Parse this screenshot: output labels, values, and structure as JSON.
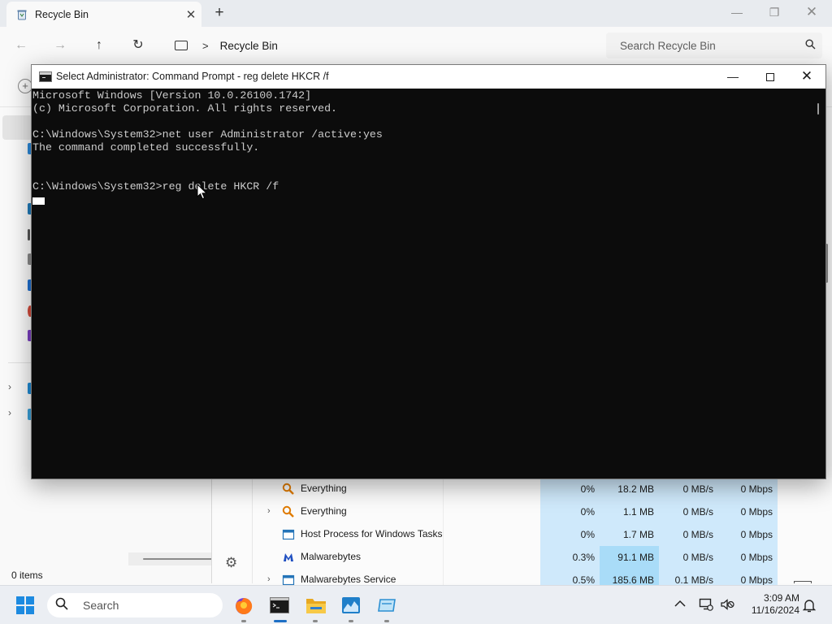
{
  "explorer": {
    "tab_title": "Recycle Bin",
    "tab_close": "✕",
    "new_tab": "+",
    "caption": {
      "minimize": "—",
      "maximize": "❐",
      "close": "✕"
    },
    "nav": {
      "back": "←",
      "forward": "→",
      "up": "↑",
      "refresh": "↻"
    },
    "breadcrumb_sep": ">",
    "breadcrumb": "Recycle Bin",
    "search_placeholder": "Search Recycle Bin",
    "status": "0 items"
  },
  "cmd": {
    "title": "Select Administrator: Command Prompt - reg  delete HKCR /f",
    "caption": {
      "minimize": "—",
      "close": "✕"
    },
    "lines": [
      "Microsoft Windows [Version 10.0.26100.1742]",
      "(c) Microsoft Corporation. All rights reserved.",
      "",
      "C:\\Windows\\System32>net user Administrator /active:yes",
      "The command completed successfully.",
      "",
      "",
      "C:\\Windows\\System32>reg delete HKCR /f"
    ]
  },
  "taskmgr": {
    "rows": [
      {
        "name": "Everything",
        "icon": "everything-icon",
        "expandable": false,
        "cpu": "0%",
        "memory": "18.2 MB",
        "disk": "0 MB/s",
        "network": "0 Mbps",
        "mem_hot": false
      },
      {
        "name": "Everything",
        "icon": "everything-icon",
        "expandable": true,
        "cpu": "0%",
        "memory": "1.1 MB",
        "disk": "0 MB/s",
        "network": "0 Mbps",
        "mem_hot": false
      },
      {
        "name": "Host Process for Windows Tasks",
        "icon": "host-process-icon",
        "expandable": false,
        "cpu": "0%",
        "memory": "1.7 MB",
        "disk": "0 MB/s",
        "network": "0 Mbps",
        "mem_hot": false
      },
      {
        "name": "Malwarebytes",
        "icon": "malwarebytes-icon",
        "expandable": false,
        "cpu": "0.3%",
        "memory": "91.1 MB",
        "disk": "0 MB/s",
        "network": "0 Mbps",
        "mem_hot": true
      },
      {
        "name": "Malwarebytes Service",
        "icon": "service-icon",
        "expandable": true,
        "cpu": "0.5%",
        "memory": "185.6 MB",
        "disk": "0.1 MB/s",
        "network": "0 Mbps",
        "mem_hot": true
      }
    ]
  },
  "taskbar": {
    "search_label": "Search",
    "apps": [
      {
        "name": "firefox",
        "icon": "firefox-icon",
        "active": false
      },
      {
        "name": "command-prompt",
        "icon": "command-prompt-icon",
        "active": true
      },
      {
        "name": "file-explorer",
        "icon": "folder-icon",
        "active": false
      },
      {
        "name": "task-manager",
        "icon": "task-manager-icon",
        "active": false
      },
      {
        "name": "app",
        "icon": "app-icon",
        "active": false
      }
    ],
    "tray_chevron": "^",
    "time": "3:09 AM",
    "date": "11/16/2024"
  },
  "colors": {
    "accent": "#1d6fc5",
    "cmd_background": "#0c0c0c",
    "cmd_text": "#cccccc",
    "taskmgr_highlight": "#cfe9fb",
    "taskmgr_highlight_strong": "#a9dcf8"
  }
}
